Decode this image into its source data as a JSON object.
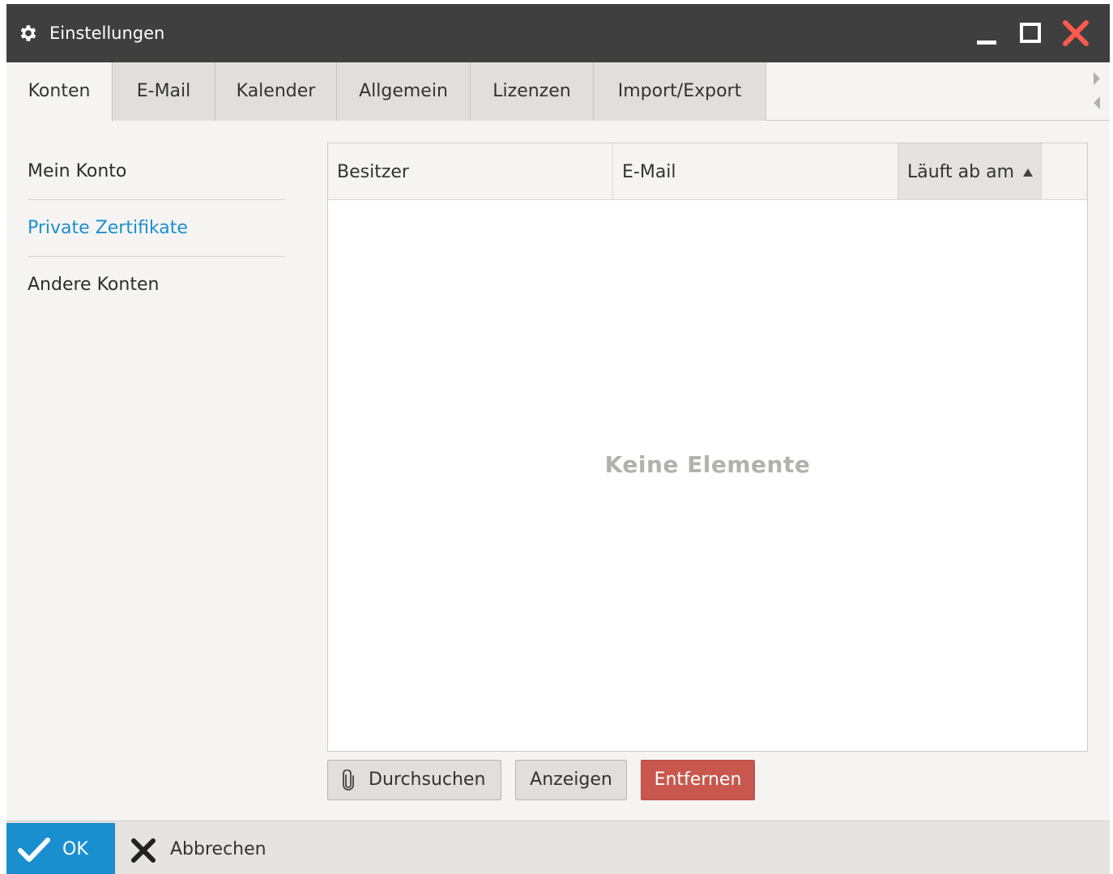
{
  "window": {
    "title": "Einstellungen",
    "title_icon": "gear-icon",
    "controls": [
      "minimize-icon",
      "maximize-icon",
      "close-icon"
    ],
    "close_color": "#ff5a4e"
  },
  "tabs": [
    {
      "label": "Konten",
      "active": true
    },
    {
      "label": "E-Mail",
      "active": false
    },
    {
      "label": "Kalender",
      "active": false
    },
    {
      "label": "Allgemein",
      "active": false
    },
    {
      "label": "Lizenzen",
      "active": false
    },
    {
      "label": "Import/Export",
      "active": false
    }
  ],
  "sidebar": {
    "items": [
      {
        "label": "Mein Konto",
        "selected": false
      },
      {
        "label": "Private Zertifikate",
        "selected": true
      },
      {
        "label": "Andere Konten",
        "selected": false
      }
    ],
    "selected_color": "#1a8fd0"
  },
  "table": {
    "columns": [
      {
        "label": "Besitzer"
      },
      {
        "label": "E-Mail"
      },
      {
        "label": "Läuft ab am",
        "sorted": "ascending"
      }
    ],
    "rows": [],
    "empty_message": "Keine Elemente"
  },
  "actions": {
    "browse_label": "Durchsuchen",
    "browse_icon": "paperclip-icon",
    "show_label": "Anzeigen",
    "remove_label": "Entfernen",
    "remove_color": "#c9574d"
  },
  "footer": {
    "ok_label": "OK",
    "ok_icon": "checkmark-icon",
    "cancel_label": "Abbrechen",
    "cancel_icon": "x-icon",
    "accent": "#1a8fd0"
  }
}
